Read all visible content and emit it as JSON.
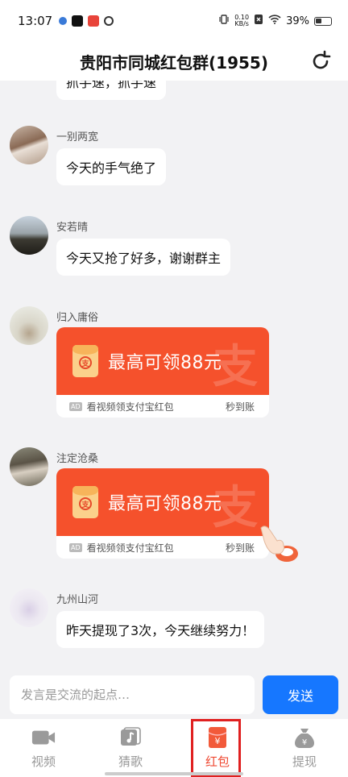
{
  "status_bar": {
    "time": "13:07",
    "net_speed_value": "0.10",
    "net_speed_unit": "KB/s",
    "battery": "39%"
  },
  "header": {
    "title": "贵阳市同城红包群(1955)",
    "refresh_icon": "refresh-icon"
  },
  "messages": [
    {
      "nickname": "",
      "text": "抓手速，抓手速",
      "partial": true
    },
    {
      "nickname": "一别两宽",
      "text": "今天的手气绝了"
    },
    {
      "nickname": "安若晴",
      "text": "今天又抢了好多，谢谢群主"
    },
    {
      "nickname": "归入庸俗",
      "red_packet": {
        "title": "最高可领88元",
        "ad_tag": "AD",
        "subtitle": "看视频领支付宝红包",
        "right_label": "秒到账",
        "icon_char": "支",
        "watermark": "支"
      }
    },
    {
      "nickname": "注定沧桑",
      "red_packet": {
        "title": "最高可领88元",
        "ad_tag": "AD",
        "subtitle": "看视频领支付宝红包",
        "right_label": "秒到账",
        "icon_char": "支",
        "watermark": "支"
      }
    },
    {
      "nickname": "九州山河",
      "text": "昨天提现了3次，今天继续努力！"
    }
  ],
  "input": {
    "placeholder": "发言是交流的起点…",
    "send_label": "发送"
  },
  "tabs": [
    {
      "label": "视频",
      "icon": "video-icon",
      "active": false
    },
    {
      "label": "猜歌",
      "icon": "music-icon",
      "active": false
    },
    {
      "label": "红包",
      "icon": "red-packet-icon",
      "active": true
    },
    {
      "label": "提现",
      "icon": "money-bag-icon",
      "active": false
    }
  ],
  "colors": {
    "accent_red": "#f5512c",
    "send_blue": "#1677ff",
    "active_tab": "#ef4a33",
    "highlight_box": "#e02020"
  }
}
